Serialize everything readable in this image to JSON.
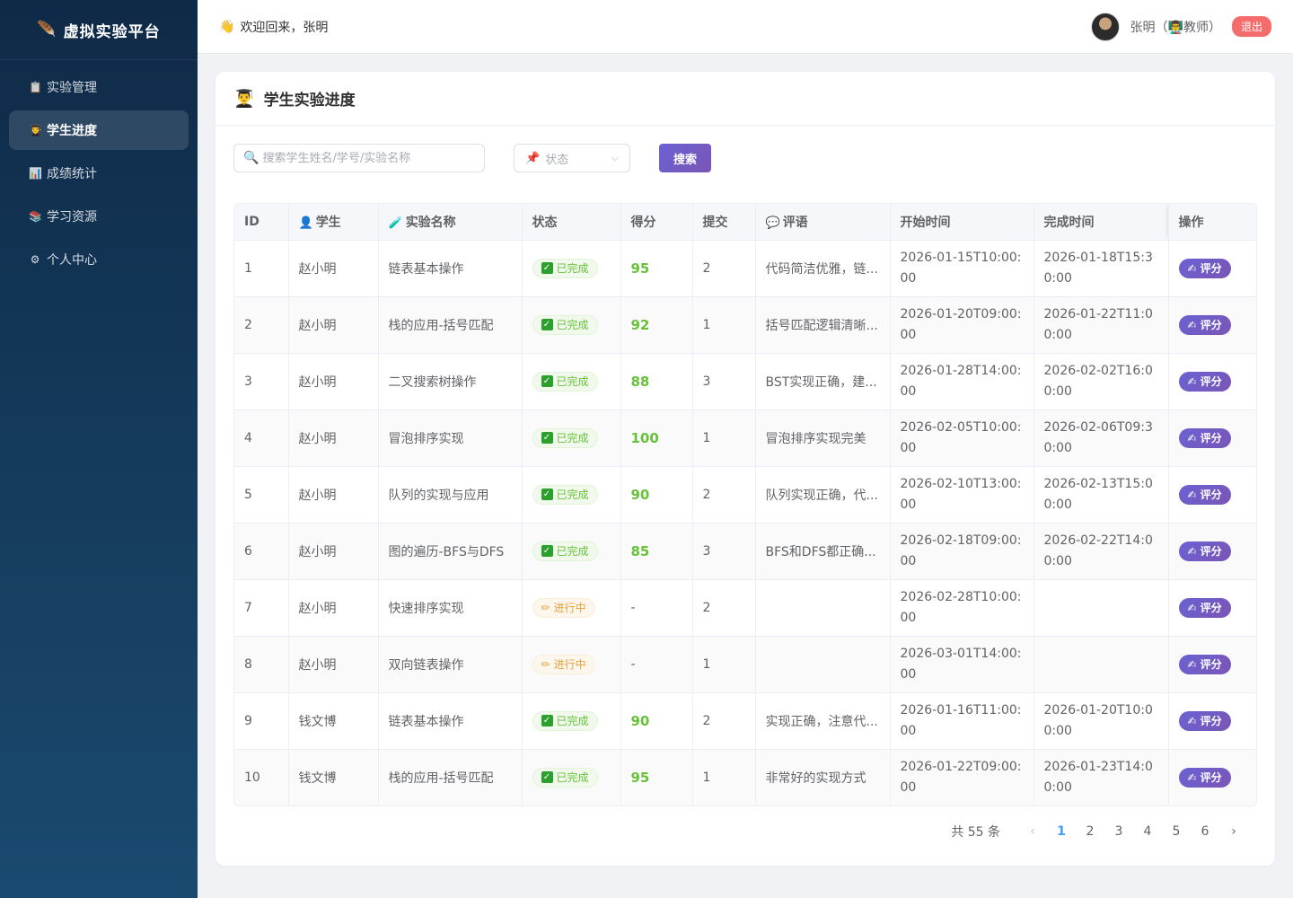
{
  "app": {
    "brand_icon": "🪶",
    "brand_title": "虚拟实验平台"
  },
  "sidebar": {
    "items": [
      {
        "icon": "📋",
        "label": "实验管理",
        "active": false
      },
      {
        "icon": "👨‍🎓",
        "label": "学生进度",
        "active": true
      },
      {
        "icon": "📊",
        "label": "成绩统计",
        "active": false
      },
      {
        "icon": "📚",
        "label": "学习资源",
        "active": false
      },
      {
        "icon": "⚙",
        "label": "个人中心",
        "active": false
      }
    ]
  },
  "header": {
    "welcome_icon": "👋",
    "welcome_text": "欢迎回来，张明",
    "user_label": "张明（👨‍🏫教师）",
    "logout_label": "退出"
  },
  "page": {
    "title_icon": "👨‍🎓",
    "title": "学生实验进度",
    "search_placeholder": "搜索学生姓名/学号/实验名称",
    "status_placeholder": "状态",
    "search_button": "搜索"
  },
  "table": {
    "headers": {
      "id": "ID",
      "student_icon": "👤",
      "student": "学生",
      "experiment_icon": "🧪",
      "experiment": "实验名称",
      "status": "状态",
      "score": "得分",
      "submissions": "提交",
      "comment_icon": "💬",
      "comment": "评语",
      "start": "开始时间",
      "finish": "完成时间",
      "action": "操作"
    },
    "grade_icon": "✍",
    "grade_label": "评分",
    "status_colors": {
      "done": "#67c23a",
      "doing": "#e6a23c"
    },
    "rows": [
      {
        "id": "1",
        "student": "赵小明",
        "experiment": "链表基本操作",
        "status": "已完成",
        "state": "done",
        "score": "95",
        "submissions": "2",
        "comment": "代码简洁优雅，链...",
        "start": "2026-01-15T10:00:00",
        "finish": "2026-01-18T15:30:00"
      },
      {
        "id": "2",
        "student": "赵小明",
        "experiment": "栈的应用-括号匹配",
        "status": "已完成",
        "state": "done",
        "score": "92",
        "submissions": "1",
        "comment": "括号匹配逻辑清晰...",
        "start": "2026-01-20T09:00:00",
        "finish": "2026-01-22T11:00:00"
      },
      {
        "id": "3",
        "student": "赵小明",
        "experiment": "二叉搜索树操作",
        "status": "已完成",
        "state": "done",
        "score": "88",
        "submissions": "3",
        "comment": "BST实现正确，建...",
        "start": "2026-01-28T14:00:00",
        "finish": "2026-02-02T16:00:00"
      },
      {
        "id": "4",
        "student": "赵小明",
        "experiment": "冒泡排序实现",
        "status": "已完成",
        "state": "done",
        "score": "100",
        "submissions": "1",
        "comment": "冒泡排序实现完美",
        "start": "2026-02-05T10:00:00",
        "finish": "2026-02-06T09:30:00"
      },
      {
        "id": "5",
        "student": "赵小明",
        "experiment": "队列的实现与应用",
        "status": "已完成",
        "state": "done",
        "score": "90",
        "submissions": "2",
        "comment": "队列实现正确，代...",
        "start": "2026-02-10T13:00:00",
        "finish": "2026-02-13T15:00:00"
      },
      {
        "id": "6",
        "student": "赵小明",
        "experiment": "图的遍历-BFS与DFS",
        "status": "已完成",
        "state": "done",
        "score": "85",
        "submissions": "3",
        "comment": "BFS和DFS都正确...",
        "start": "2026-02-18T09:00:00",
        "finish": "2026-02-22T14:00:00"
      },
      {
        "id": "7",
        "student": "赵小明",
        "experiment": "快速排序实现",
        "status": "进行中",
        "state": "doing",
        "score": "-",
        "submissions": "2",
        "comment": "",
        "start": "2026-02-28T10:00:00",
        "finish": ""
      },
      {
        "id": "8",
        "student": "赵小明",
        "experiment": "双向链表操作",
        "status": "进行中",
        "state": "doing",
        "score": "-",
        "submissions": "1",
        "comment": "",
        "start": "2026-03-01T14:00:00",
        "finish": ""
      },
      {
        "id": "9",
        "student": "钱文博",
        "experiment": "链表基本操作",
        "status": "已完成",
        "state": "done",
        "score": "90",
        "submissions": "2",
        "comment": "实现正确，注意代...",
        "start": "2026-01-16T11:00:00",
        "finish": "2026-01-20T10:00:00"
      },
      {
        "id": "10",
        "student": "钱文博",
        "experiment": "栈的应用-括号匹配",
        "status": "已完成",
        "state": "done",
        "score": "95",
        "submissions": "1",
        "comment": "非常好的实现方式",
        "start": "2026-01-22T09:00:00",
        "finish": "2026-01-23T14:00:00"
      }
    ]
  },
  "pagination": {
    "total_label": "共 55 条",
    "prev": "‹",
    "next": "›",
    "pages": [
      "1",
      "2",
      "3",
      "4",
      "5",
      "6"
    ],
    "current": "1"
  }
}
